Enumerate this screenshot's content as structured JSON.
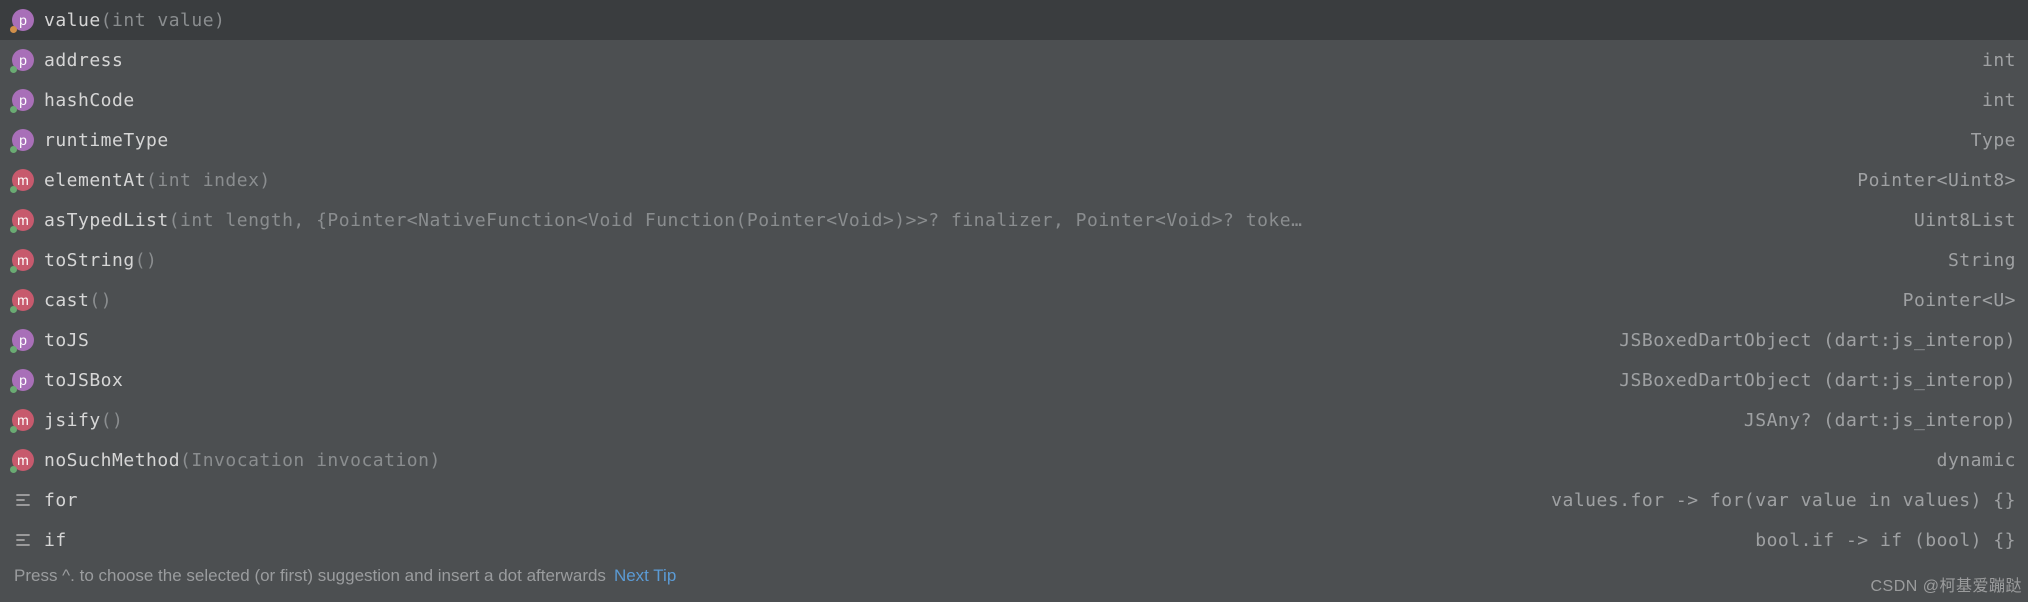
{
  "items": [
    {
      "kind": "property",
      "dot": "orange",
      "name": "value",
      "params": "(int value)",
      "return": "",
      "selected": true
    },
    {
      "kind": "property",
      "dot": "green",
      "name": "address",
      "params": "",
      "return": "int"
    },
    {
      "kind": "property",
      "dot": "green",
      "name": "hashCode",
      "params": "",
      "return": "int"
    },
    {
      "kind": "property",
      "dot": "green",
      "name": "runtimeType",
      "params": "",
      "return": "Type"
    },
    {
      "kind": "method",
      "dot": "green",
      "name": "elementAt",
      "params": "(int index)",
      "return": "Pointer<Uint8>"
    },
    {
      "kind": "method",
      "dot": "green",
      "name": "asTypedList",
      "params": "(int length, {Pointer<NativeFunction<Void Function(Pointer<Void>)>>? finalizer, Pointer<Void>? toke…",
      "return": "Uint8List"
    },
    {
      "kind": "method",
      "dot": "green",
      "name": "toString",
      "params": "()",
      "return": "String"
    },
    {
      "kind": "method",
      "dot": "green",
      "name": "cast",
      "params": "()",
      "return": "Pointer<U>"
    },
    {
      "kind": "property",
      "dot": "green",
      "name": "toJS",
      "params": "",
      "return": "JSBoxedDartObject (dart:js_interop)"
    },
    {
      "kind": "property",
      "dot": "green",
      "name": "toJSBox",
      "params": "",
      "return": "JSBoxedDartObject (dart:js_interop)"
    },
    {
      "kind": "method",
      "dot": "green",
      "name": "jsify",
      "params": "()",
      "return": "JSAny? (dart:js_interop)"
    },
    {
      "kind": "method",
      "dot": "green",
      "name": "noSuchMethod",
      "params": "(Invocation invocation)",
      "return": "dynamic"
    },
    {
      "kind": "template",
      "name": "for",
      "params": "",
      "return": "values.for -> for(var value in values) {}"
    },
    {
      "kind": "template",
      "name": "if",
      "params": "",
      "return": "bool.if -> if (bool) {}"
    }
  ],
  "footer": {
    "hint": "Press ^. to choose the selected (or first) suggestion and insert a dot afterwards",
    "link": "Next Tip"
  },
  "watermark": "CSDN @柯基爱蹦跶"
}
